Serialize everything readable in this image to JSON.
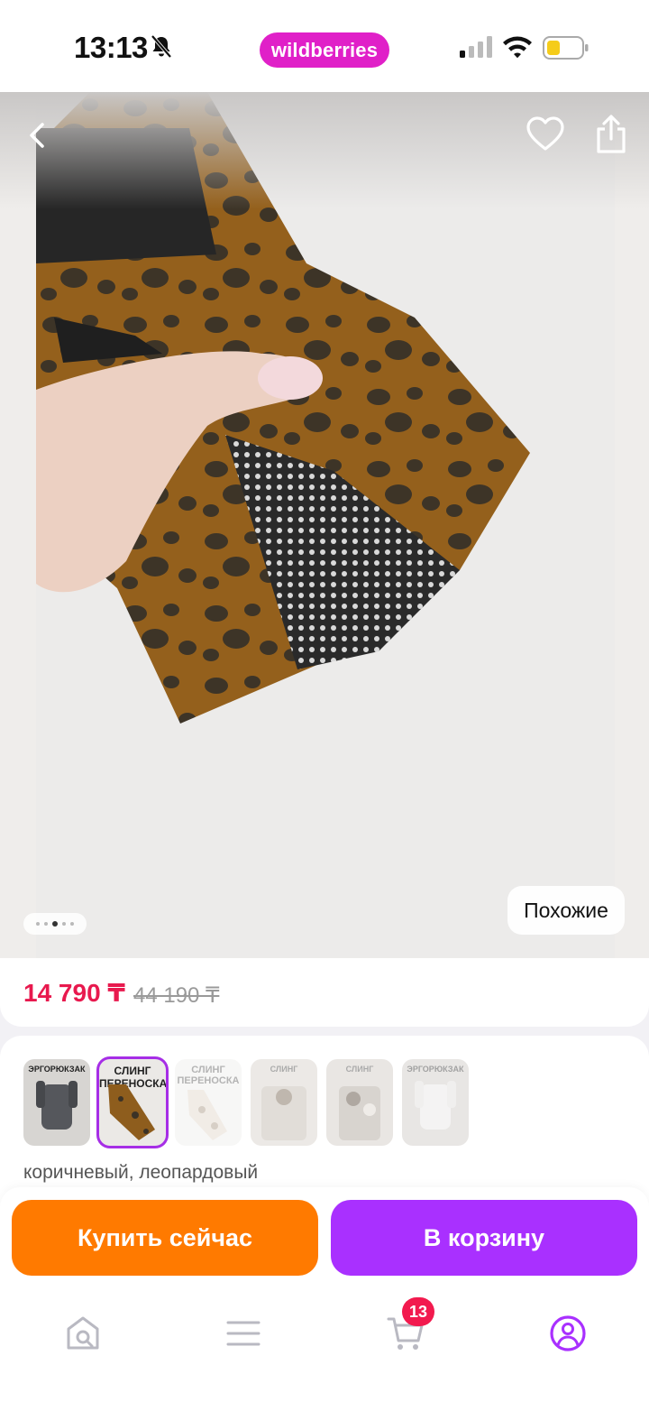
{
  "status_bar": {
    "time": "13:13",
    "brand": "wildberries",
    "brand_color": "#e020c8"
  },
  "hero": {
    "icons": [
      "back-icon",
      "heart-icon",
      "share-icon"
    ],
    "similar_label": "Похожие",
    "gallery_count": 5,
    "gallery_active_index": 2
  },
  "price": {
    "current": "14 790 ₸",
    "old": "44 190 ₸",
    "current_color": "#e8194e"
  },
  "variants": {
    "thumbnails": [
      {
        "title": "ЭРГОРЮКЗАК",
        "selected": false
      },
      {
        "title": "СЛИНГ ПЕРЕНОСКА",
        "selected": true
      },
      {
        "title": "СЛИНГ ПЕРЕНОСКА",
        "selected": false
      },
      {
        "title": "СЛИНГ",
        "selected": false
      },
      {
        "title": "СЛИНГ",
        "selected": false
      },
      {
        "title": "ЭРГОРЮКЗАК",
        "selected": false
      }
    ],
    "selected_color_name": "коричневый, леопардовый",
    "selected_border_color": "#a62ee6"
  },
  "actions": {
    "buy_now": "Купить сейчас",
    "add_to_cart": "В корзину",
    "buy_color": "#ff7a00",
    "cart_color": "#a930ff"
  },
  "tab_bar": {
    "tabs": [
      "home-search-icon",
      "menu-icon",
      "cart-icon",
      "profile-icon"
    ],
    "cart_badge": "13",
    "active_tab": "profile-icon",
    "active_color": "#a930ff"
  }
}
